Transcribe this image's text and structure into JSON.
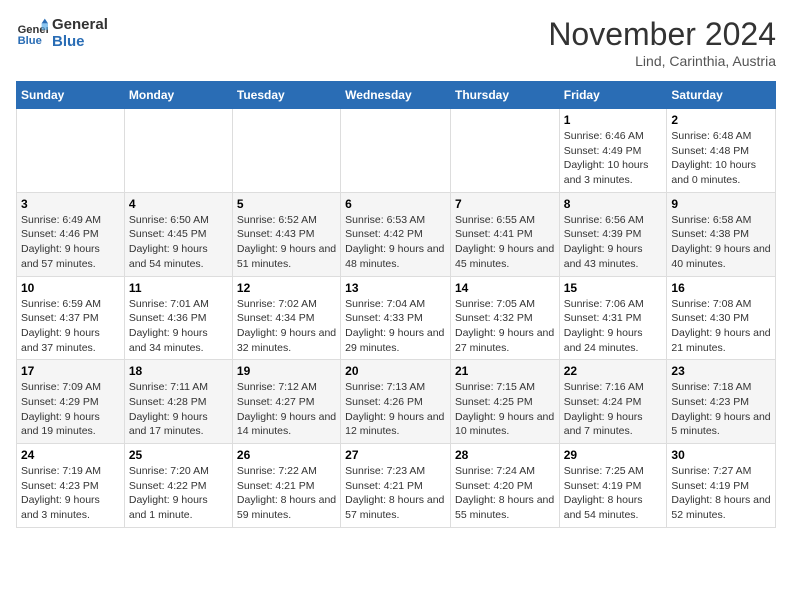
{
  "header": {
    "logo_line1": "General",
    "logo_line2": "Blue",
    "month_title": "November 2024",
    "subtitle": "Lind, Carinthia, Austria"
  },
  "weekdays": [
    "Sunday",
    "Monday",
    "Tuesday",
    "Wednesday",
    "Thursday",
    "Friday",
    "Saturday"
  ],
  "weeks": [
    [
      {
        "day": "",
        "info": ""
      },
      {
        "day": "",
        "info": ""
      },
      {
        "day": "",
        "info": ""
      },
      {
        "day": "",
        "info": ""
      },
      {
        "day": "",
        "info": ""
      },
      {
        "day": "1",
        "info": "Sunrise: 6:46 AM\nSunset: 4:49 PM\nDaylight: 10 hours and 3 minutes."
      },
      {
        "day": "2",
        "info": "Sunrise: 6:48 AM\nSunset: 4:48 PM\nDaylight: 10 hours and 0 minutes."
      }
    ],
    [
      {
        "day": "3",
        "info": "Sunrise: 6:49 AM\nSunset: 4:46 PM\nDaylight: 9 hours and 57 minutes."
      },
      {
        "day": "4",
        "info": "Sunrise: 6:50 AM\nSunset: 4:45 PM\nDaylight: 9 hours and 54 minutes."
      },
      {
        "day": "5",
        "info": "Sunrise: 6:52 AM\nSunset: 4:43 PM\nDaylight: 9 hours and 51 minutes."
      },
      {
        "day": "6",
        "info": "Sunrise: 6:53 AM\nSunset: 4:42 PM\nDaylight: 9 hours and 48 minutes."
      },
      {
        "day": "7",
        "info": "Sunrise: 6:55 AM\nSunset: 4:41 PM\nDaylight: 9 hours and 45 minutes."
      },
      {
        "day": "8",
        "info": "Sunrise: 6:56 AM\nSunset: 4:39 PM\nDaylight: 9 hours and 43 minutes."
      },
      {
        "day": "9",
        "info": "Sunrise: 6:58 AM\nSunset: 4:38 PM\nDaylight: 9 hours and 40 minutes."
      }
    ],
    [
      {
        "day": "10",
        "info": "Sunrise: 6:59 AM\nSunset: 4:37 PM\nDaylight: 9 hours and 37 minutes."
      },
      {
        "day": "11",
        "info": "Sunrise: 7:01 AM\nSunset: 4:36 PM\nDaylight: 9 hours and 34 minutes."
      },
      {
        "day": "12",
        "info": "Sunrise: 7:02 AM\nSunset: 4:34 PM\nDaylight: 9 hours and 32 minutes."
      },
      {
        "day": "13",
        "info": "Sunrise: 7:04 AM\nSunset: 4:33 PM\nDaylight: 9 hours and 29 minutes."
      },
      {
        "day": "14",
        "info": "Sunrise: 7:05 AM\nSunset: 4:32 PM\nDaylight: 9 hours and 27 minutes."
      },
      {
        "day": "15",
        "info": "Sunrise: 7:06 AM\nSunset: 4:31 PM\nDaylight: 9 hours and 24 minutes."
      },
      {
        "day": "16",
        "info": "Sunrise: 7:08 AM\nSunset: 4:30 PM\nDaylight: 9 hours and 21 minutes."
      }
    ],
    [
      {
        "day": "17",
        "info": "Sunrise: 7:09 AM\nSunset: 4:29 PM\nDaylight: 9 hours and 19 minutes."
      },
      {
        "day": "18",
        "info": "Sunrise: 7:11 AM\nSunset: 4:28 PM\nDaylight: 9 hours and 17 minutes."
      },
      {
        "day": "19",
        "info": "Sunrise: 7:12 AM\nSunset: 4:27 PM\nDaylight: 9 hours and 14 minutes."
      },
      {
        "day": "20",
        "info": "Sunrise: 7:13 AM\nSunset: 4:26 PM\nDaylight: 9 hours and 12 minutes."
      },
      {
        "day": "21",
        "info": "Sunrise: 7:15 AM\nSunset: 4:25 PM\nDaylight: 9 hours and 10 minutes."
      },
      {
        "day": "22",
        "info": "Sunrise: 7:16 AM\nSunset: 4:24 PM\nDaylight: 9 hours and 7 minutes."
      },
      {
        "day": "23",
        "info": "Sunrise: 7:18 AM\nSunset: 4:23 PM\nDaylight: 9 hours and 5 minutes."
      }
    ],
    [
      {
        "day": "24",
        "info": "Sunrise: 7:19 AM\nSunset: 4:23 PM\nDaylight: 9 hours and 3 minutes."
      },
      {
        "day": "25",
        "info": "Sunrise: 7:20 AM\nSunset: 4:22 PM\nDaylight: 9 hours and 1 minute."
      },
      {
        "day": "26",
        "info": "Sunrise: 7:22 AM\nSunset: 4:21 PM\nDaylight: 8 hours and 59 minutes."
      },
      {
        "day": "27",
        "info": "Sunrise: 7:23 AM\nSunset: 4:21 PM\nDaylight: 8 hours and 57 minutes."
      },
      {
        "day": "28",
        "info": "Sunrise: 7:24 AM\nSunset: 4:20 PM\nDaylight: 8 hours and 55 minutes."
      },
      {
        "day": "29",
        "info": "Sunrise: 7:25 AM\nSunset: 4:19 PM\nDaylight: 8 hours and 54 minutes."
      },
      {
        "day": "30",
        "info": "Sunrise: 7:27 AM\nSunset: 4:19 PM\nDaylight: 8 hours and 52 minutes."
      }
    ]
  ]
}
